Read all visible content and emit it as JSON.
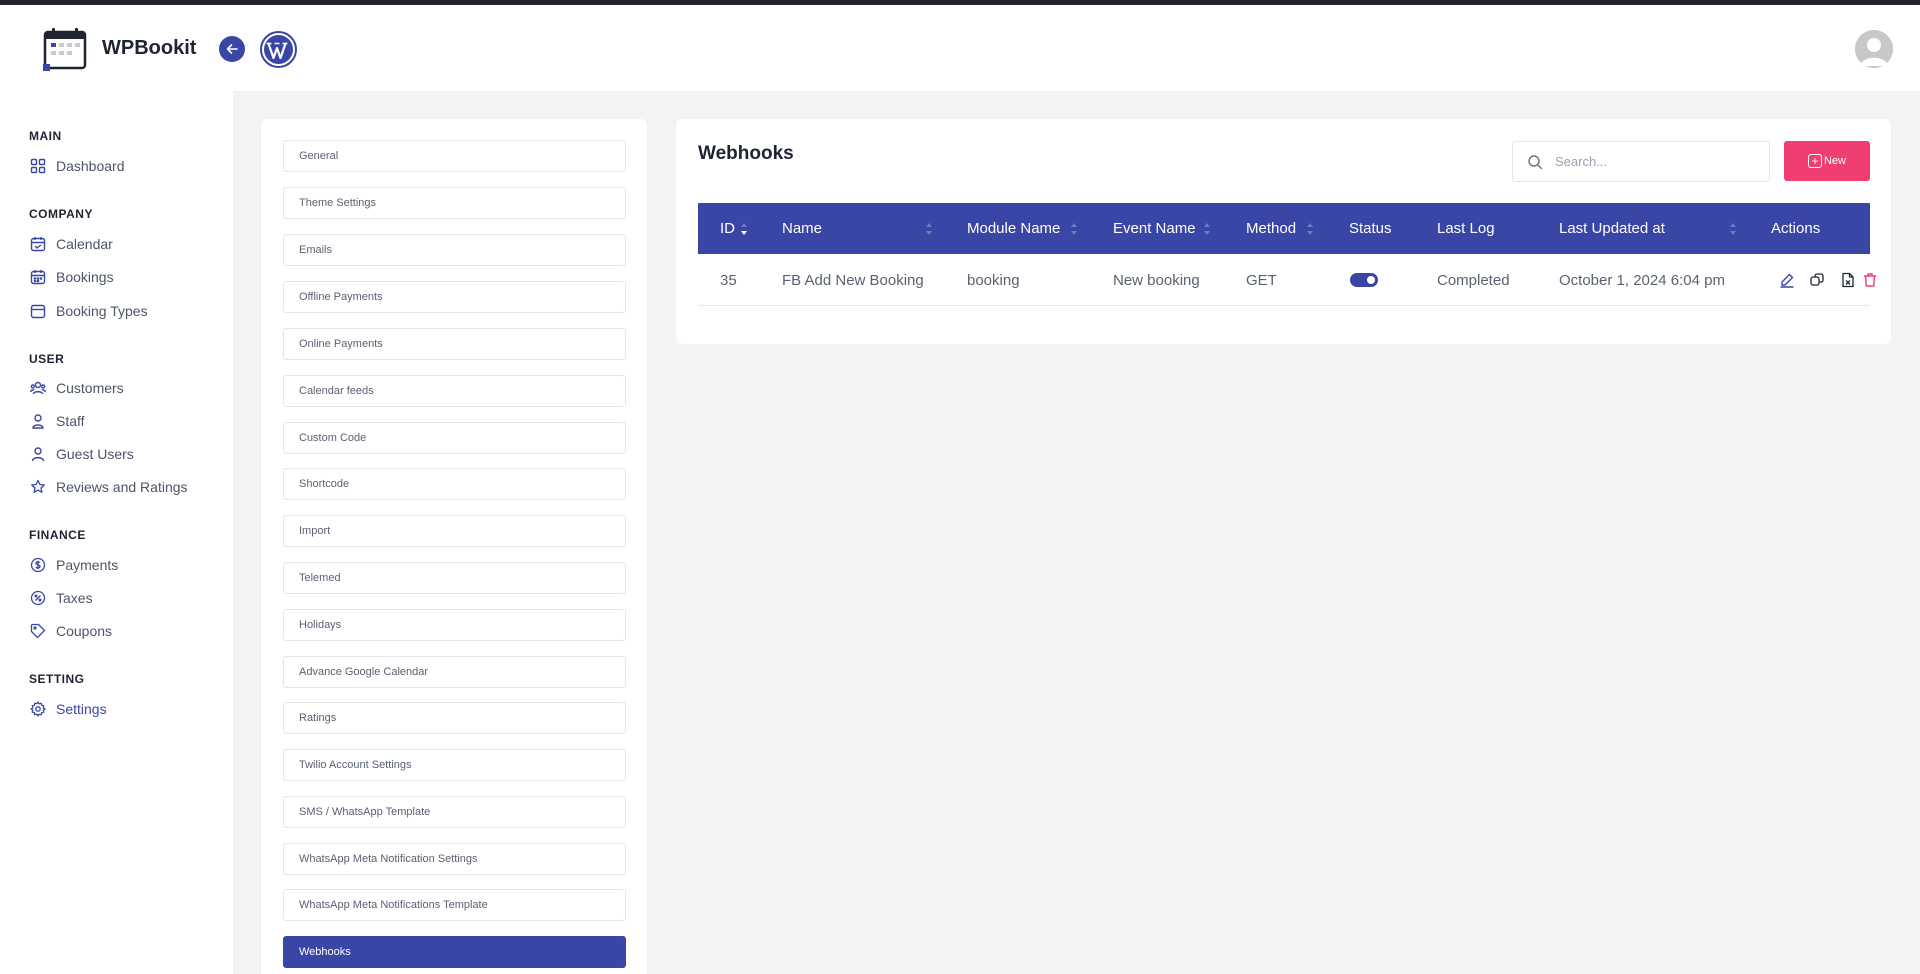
{
  "app": {
    "name": "WPBookit",
    "back_icon": "arrow-left-icon",
    "wp_icon": "wordpress-icon",
    "avatar_icon": "user-avatar-icon",
    "accent": "#3946a6",
    "danger": "#ef3f72"
  },
  "sidebar": {
    "sections": [
      {
        "title": "MAIN",
        "items": [
          {
            "label": "Dashboard",
            "icon": "dashboard-icon"
          }
        ]
      },
      {
        "title": "COMPANY",
        "items": [
          {
            "label": "Calendar",
            "icon": "calendar-icon"
          },
          {
            "label": "Bookings",
            "icon": "bookings-icon"
          },
          {
            "label": "Booking Types",
            "icon": "booking-types-icon"
          }
        ]
      },
      {
        "title": "USER",
        "items": [
          {
            "label": "Customers",
            "icon": "customers-icon"
          },
          {
            "label": "Staff",
            "icon": "staff-icon"
          },
          {
            "label": "Guest Users",
            "icon": "guest-users-icon"
          },
          {
            "label": "Reviews and Ratings",
            "icon": "star-icon"
          }
        ]
      },
      {
        "title": "FINANCE",
        "items": [
          {
            "label": "Payments",
            "icon": "dollar-icon"
          },
          {
            "label": "Taxes",
            "icon": "percent-icon"
          },
          {
            "label": "Coupons",
            "icon": "tag-icon"
          }
        ]
      },
      {
        "title": "SETTING",
        "items": [
          {
            "label": "Settings",
            "icon": "gear-icon",
            "active": true
          }
        ]
      }
    ]
  },
  "settings_menu": {
    "items": [
      "General",
      "Theme Settings",
      "Emails",
      "Offline Payments",
      "Online Payments",
      "Calendar feeds",
      "Custom Code",
      "Shortcode",
      "Import",
      "Telemed",
      "Holidays",
      "Advance Google Calendar",
      "Ratings",
      "Twilio Account Settings",
      "SMS / WhatsApp Template",
      "WhatsApp Meta Notification Settings",
      "WhatsApp Meta Notifications Template",
      "Webhooks"
    ],
    "active": "Webhooks"
  },
  "webhooks": {
    "title": "Webhooks",
    "search_placeholder": "Search...",
    "new_label": "New",
    "columns": [
      "ID",
      "Name",
      "Module Name",
      "Event Name",
      "Method",
      "Status",
      "Last Log",
      "Last Updated at",
      "Actions"
    ],
    "rows": [
      {
        "id": "35",
        "name": "FB Add New Booking",
        "module": "booking",
        "event": "New booking",
        "method": "GET",
        "status_on": true,
        "last_log": "Completed",
        "updated": "October 1, 2024 6:04 pm"
      }
    ],
    "action_icons": [
      "edit-icon",
      "duplicate-icon",
      "log-file-icon",
      "delete-icon"
    ]
  }
}
